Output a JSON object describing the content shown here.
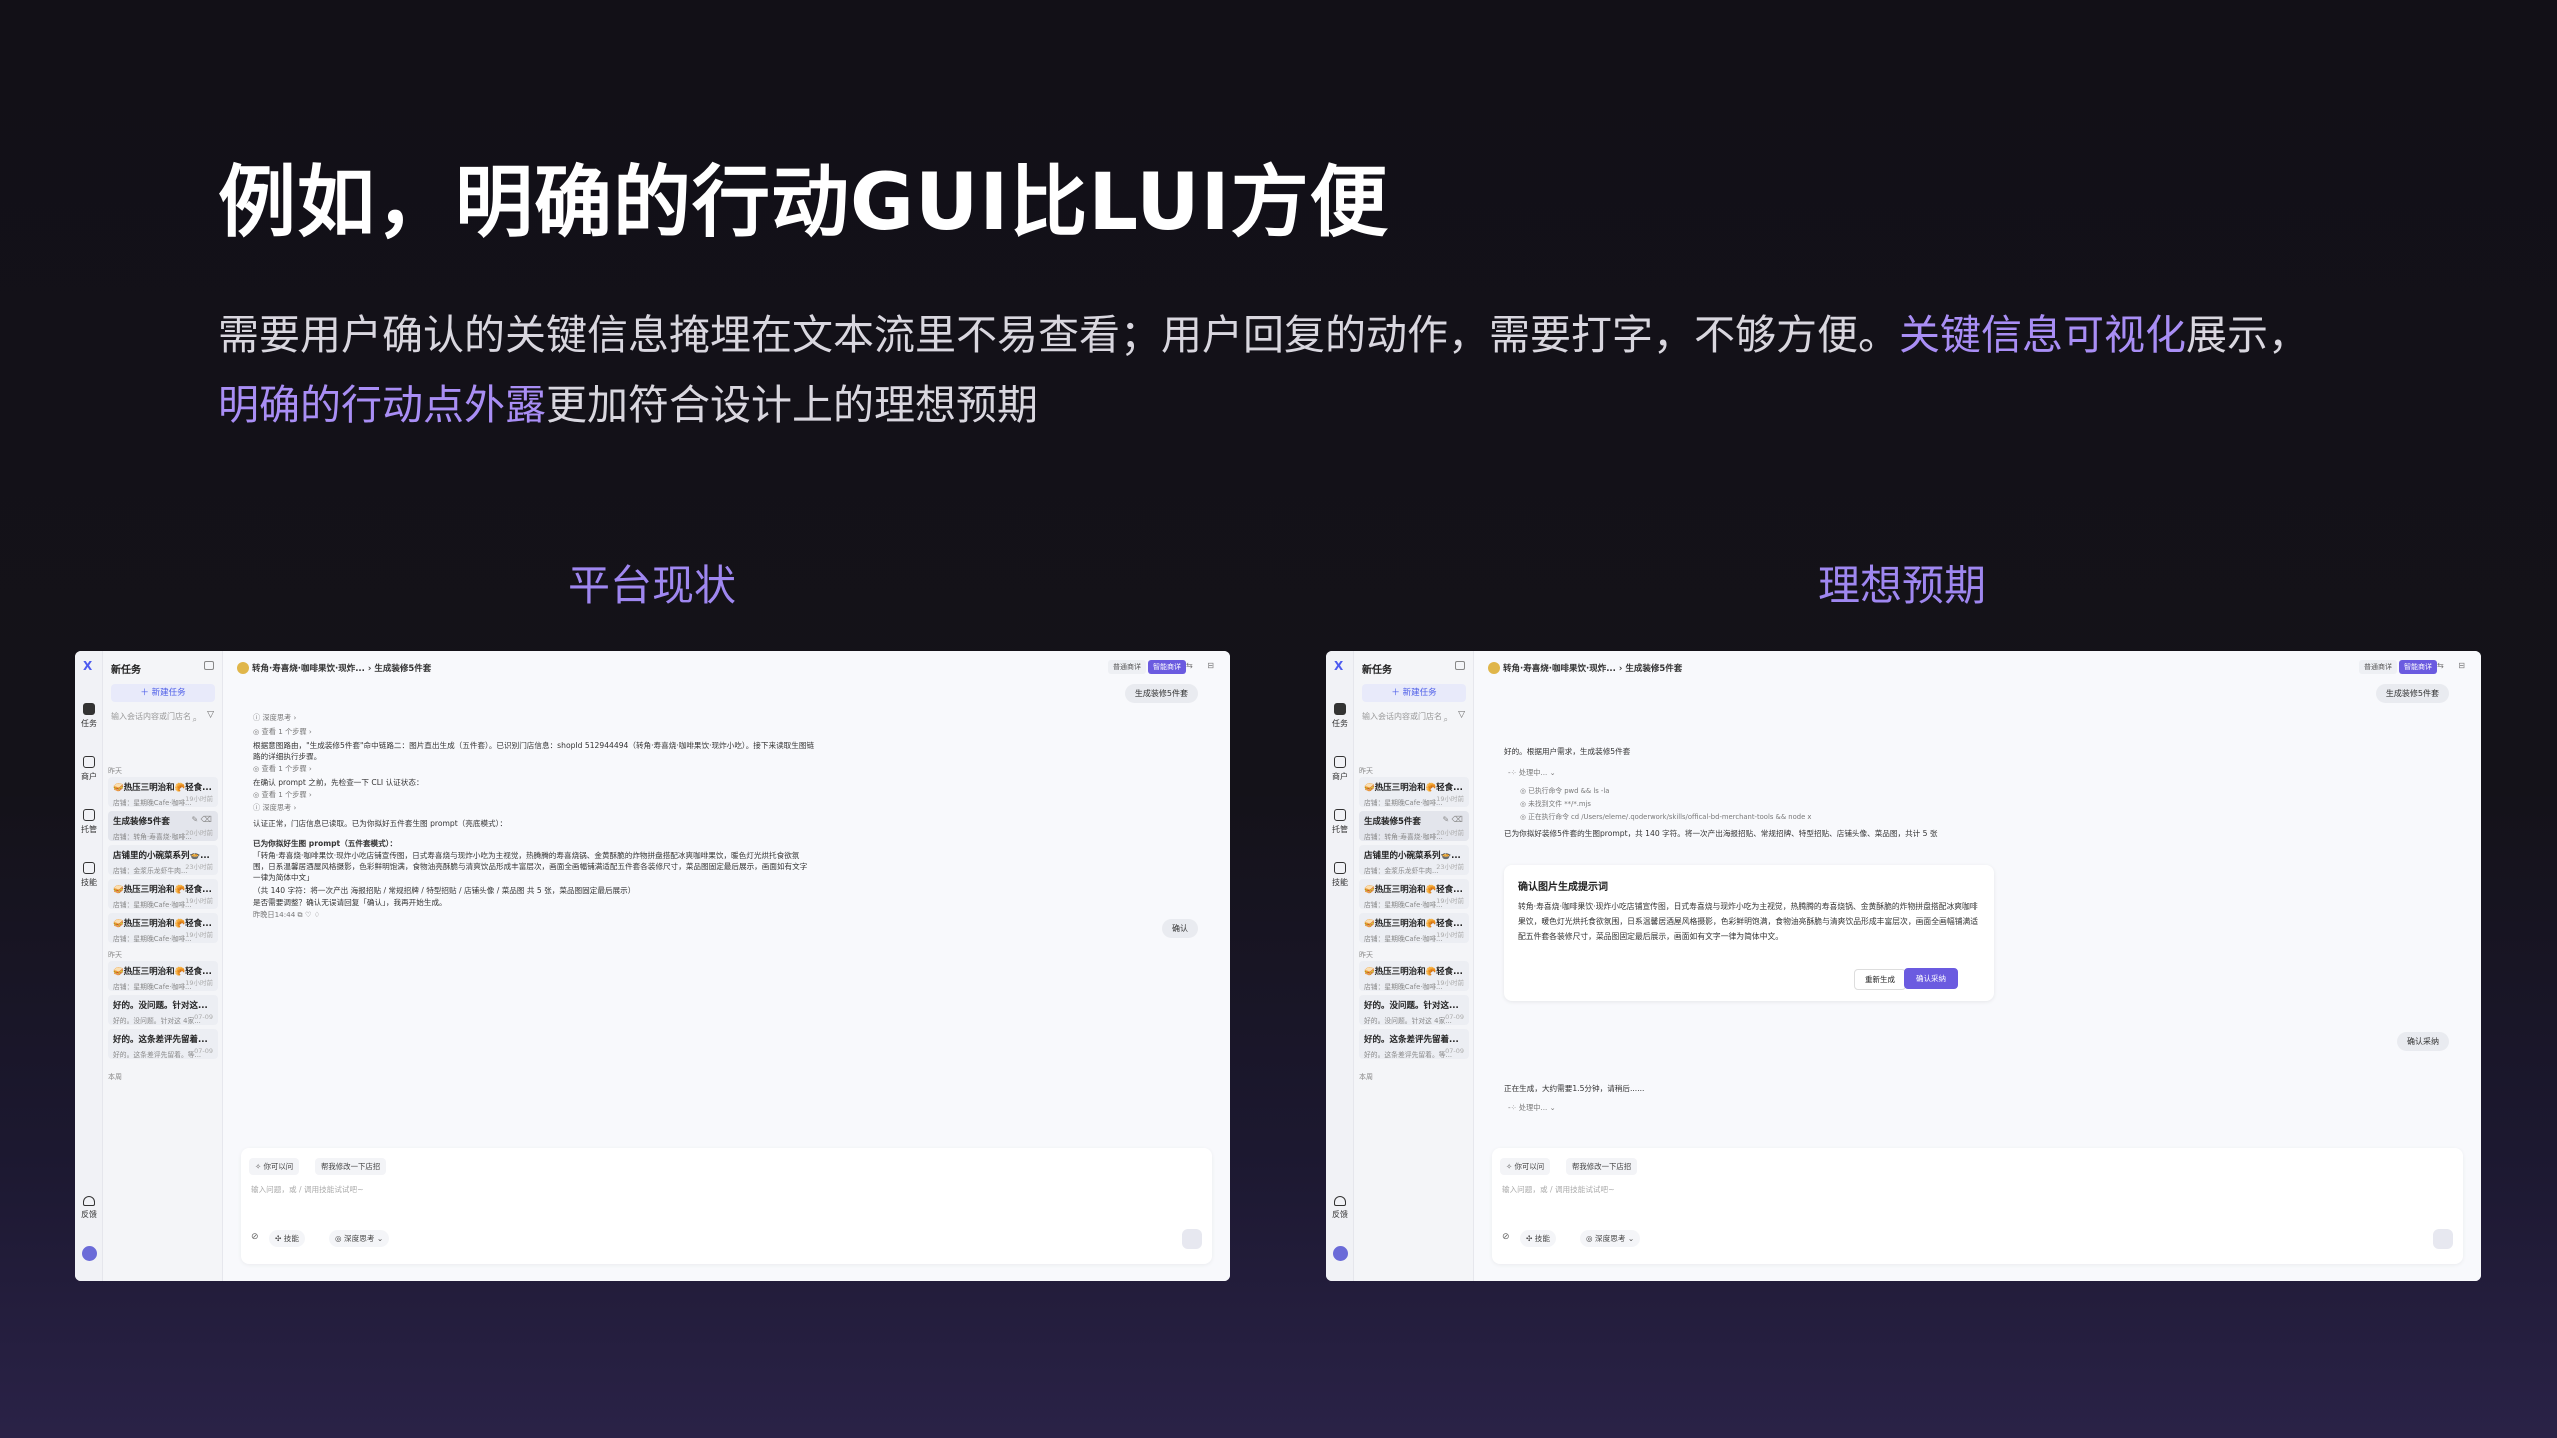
{
  "slide": {
    "title": "例如，明确的行动GUI比LUI方便",
    "desc_part1": "需要用户确认的关键信息掩埋在文本流里不易查看；用户回复的动作，需要打字，不够方便。",
    "desc_hl1": "关键信息可视化",
    "desc_part2": "展示，",
    "desc_hl2": "明确的行动点外露",
    "desc_part3": "更加符合设计上的理想预期",
    "label_left": "平台现状",
    "label_right": "理想预期",
    "accent_color": "#a98ef5"
  },
  "app": {
    "logo_icon": "X",
    "rail": [
      "任务",
      "商户",
      "托管",
      "技能"
    ],
    "feedback": "反馈",
    "sidebar_title": "新任务",
    "new_task": "＋ 新建任务",
    "search_placeholder": "输入会话内容或门店名",
    "day_yesterday": "昨天",
    "day_earlier": "昨天",
    "day_week": "本周",
    "items": [
      {
        "title": "🥪热压三明治和🥐轻食...",
        "sub": "店铺：星期晚Cafe·咖啡...",
        "time": "19小时前"
      },
      {
        "title": "生成装修5件套",
        "sub": "店铺：转角·寿喜烧·咖啡...",
        "time": "20小时前"
      },
      {
        "title": "店铺里的小碗菜系列🍲...",
        "sub": "店铺：金浆乐龙虾牛肉...",
        "time": "23小时前"
      },
      {
        "title": "🥪热压三明治和🥐轻食...",
        "sub": "店铺：星期晚Cafe·咖啡...",
        "time": "19小时前"
      },
      {
        "title": "🥪热压三明治和🥐轻食...",
        "sub": "店铺：星期晚Cafe·咖啡...",
        "time": "19小时前"
      },
      {
        "title": "🥪热压三明治和🥐轻食...",
        "sub": "店铺：星期晚Cafe·咖啡...",
        "time": "19小时前"
      },
      {
        "title": "好的。没问题。针对这...",
        "sub": "好的。没问题。针对这 4家...",
        "time": "07-09"
      },
      {
        "title": "好的。这条差评先留着...",
        "sub": "好的。这条差评先留着。等...",
        "time": "07-09"
      }
    ],
    "crumb_store": "转角·寿喜烧·咖啡果饮·现炸...",
    "crumb_sep": "›",
    "crumb_task": "生成装修5件套",
    "mode_normal": "普通商详",
    "mode_smart": "智能商详",
    "user_msg": "生成装修5件套",
    "composer_chip1": "✧ 你可以问",
    "composer_chip2": "帮我修改一下店招",
    "composer_placeholder": "输入问题，或 / 调用技能试试吧~",
    "tool_skill": "✣ 技能",
    "tool_think": "◎ 深度思考 ⌄"
  },
  "left": {
    "lines": [
      "ⓘ 深度思考  ›",
      "◎ 查看 1 个步骤  ›",
      "根据意图路由，\"生成装修5件套\"命中链路二：图片直出生成（五件套）。已识别门店信息：shopId 512944494（转角·寿喜烧·咖啡果饮·现炸小吃）。接下来读取生图链",
      "路的详细执行步骤。",
      "◎ 查看 1 个步骤  ›",
      "在确认 prompt 之前，先检查一下 CLI 认证状态：",
      "◎ 查看 1 个步骤  ›",
      "ⓘ 深度思考  ›",
      "认证正常，门店信息已读取。已为你拟好五件套生图 prompt（亮底模式）：",
      "已为你拟好生图 prompt（五件套模式）：",
      "「转角·寿喜烧·咖啡果饮·现炸小吃店铺宣传图，日式寿喜烧与现炸小吃为主视觉，热腾腾的寿喜烧锅、金黄酥脆的炸物拼盘搭配冰爽咖啡果饮，暖色灯光烘托食欲氛",
      "围，日系温馨居酒屋风格摄影，色彩鲜明饱满，食物油亮酥脆与清爽饮品形成丰富层次，画面全画幅铺满适配五件套各装修尺寸，菜品图固定最后展示，画面如有文字",
      "一律为简体中文」",
      "（共 140 字符：将一次产出 海报招贴 / 常规招牌 / 特型招贴 / 店铺头像 / 菜品图 共 5 张，菜品图固定最后展示）",
      "是否需要调整？确认无误请回复「确认」，我再开始生成。",
      "昨晚日14:44  ⧉  ♡  ♢"
    ],
    "user_confirm": "确认"
  },
  "right": {
    "lines": [
      "好的。根据用户需求，生成装修5件套",
      "-⁘ 处理中...  ⌄",
      "◎ 已执行命令  pwd && ls -la",
      "◎ 未找到文件  **/*.mjs",
      "◎ 正在执行命令  cd /Users/eleme/.qoderwork/skills/offical-bd-merchant-tools && node x",
      "已为你拟好装修5件套的生图prompt，共 140 字符。将一次产出海报招贴、常规招牌、特型招贴、店铺头像、菜品图，共计 5 张"
    ],
    "card_title": "确认图片生成提示词",
    "card_body": "转角·寿喜烧·咖啡果饮·现炸小吃店铺宣传图，日式寿喜烧与现炸小吃为主视觉，热腾腾的寿喜烧锅、金黄酥脆的炸物拼盘搭配冰爽咖啡果饮，暖色灯光烘托食欲氛围，日系温馨居酒屋风格摄影，色彩鲜明饱满，食物油亮酥脆与清爽饮品形成丰富层次，画面全画幅铺满适配五件套各装修尺寸，菜品图固定最后展示，画面如有文字一律为简体中文。",
    "regen": "重新生成",
    "accept": "确认采纳",
    "user_accept": "确认采纳",
    "gen_status": "正在生成，大约需要1.5分钟，请稍后......",
    "processing": "-⁘ 处理中...  ⌄"
  }
}
